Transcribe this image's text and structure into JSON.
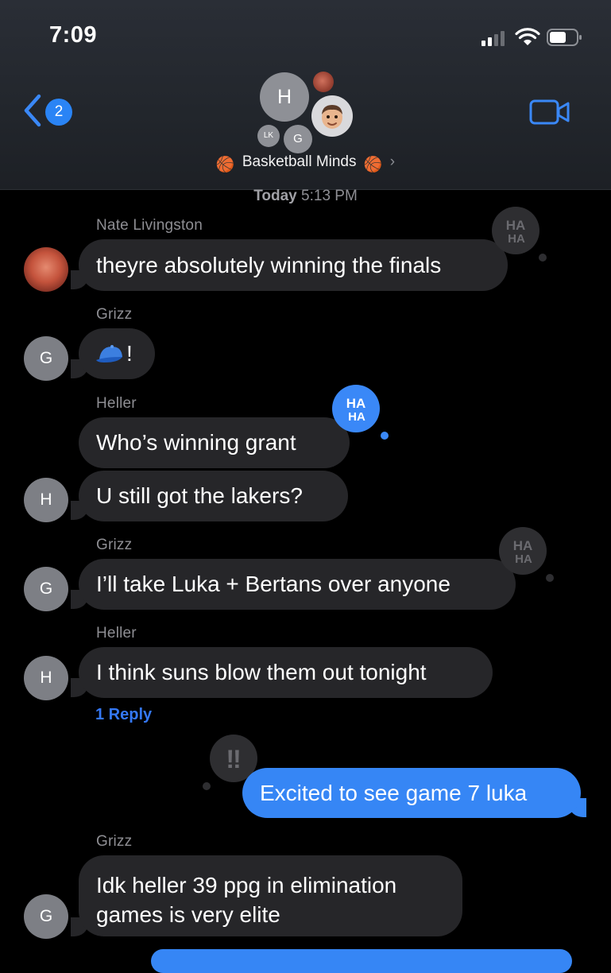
{
  "status_bar": {
    "time": "7:09"
  },
  "nav": {
    "back_count": "2",
    "group_name": "Basketball Minds",
    "group_emoji_left": "🏀",
    "group_emoji_right": "🏀",
    "members": {
      "h_initial": "H",
      "lk_initial": "LK",
      "g_initial": "G"
    }
  },
  "timestamp": {
    "day": "Today",
    "time": "5:13 PM"
  },
  "messages": [
    {
      "sender": "Nate Livingston",
      "text": "theyre absolutely winning the finals",
      "tapback": "HA HA"
    },
    {
      "sender": "Grizz",
      "text": "!",
      "avatar": "G"
    },
    {
      "sender": "Heller",
      "text": "Who’s winning grant",
      "tapback": "HA HA"
    },
    {
      "text": "U still got the lakers?",
      "avatar": "H"
    },
    {
      "sender": "Grizz",
      "text": "I’ll take Luka + Bertans over anyone",
      "avatar": "G",
      "tapback": "HA HA"
    },
    {
      "sender": "Heller",
      "text": "I think suns blow them out tonight",
      "avatar": "H"
    },
    {
      "reply": "1 Reply"
    },
    {
      "text": "Excited to see game 7 luka",
      "tapback": "‼"
    },
    {
      "sender": "Grizz",
      "text": "Idk heller 39 ppg in elimination games is very elite",
      "avatar": "G"
    }
  ],
  "colors": {
    "incoming_bubble": "#262629",
    "outgoing_bubble": "#3686f5",
    "link": "#3478f6"
  }
}
